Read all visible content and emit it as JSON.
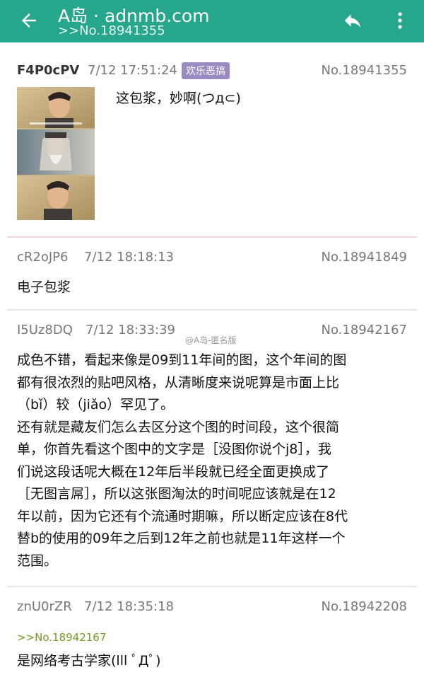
{
  "appbar": {
    "title": "A岛 · adnmb.com",
    "subtitle": ">>No.18941355",
    "back_icon": "back-arrow-icon",
    "reply_icon": "reply-icon",
    "more_icon": "more-vertical-icon",
    "color": "#26a68a"
  },
  "posts": [
    {
      "uid": "F4P0cPV",
      "time": "7/12 17:51:24",
      "tag": "欢乐恶搞",
      "no": "No.18941355",
      "content": "这包浆，妙啊(つд⊂)"
    },
    {
      "uid": "cR2oJP6",
      "time": "7/12 18:18:13",
      "no": "No.18941849",
      "content": "电子包浆"
    },
    {
      "uid": "I5Uz8DQ",
      "time": "7/12 18:33:39",
      "no": "No.18942167",
      "lines": [
        "成色不错，看起来像是09到11年间的图，这个年间的图",
        "都有很浓烈的贴吧风格，从清晰度来说呢算是市面上比",
        "（bǐ）较（jiǎo）罕见了。",
        "还有就是藏友们怎么去区分这个图的时间段，这个很简",
        "单，你首先看这个图中的文字是［没图你说个j8］，我",
        "们说这段话呢大概在12年后半段就已经全面更换成了",
        "［无图言屌］，所以这张图淘汰的时间呢应该就是在12",
        "年以前，因为它还有个流通时期嘛，所以断定应该在8代",
        "替b的使用的09年之后到12年之前也就是11年这样一个",
        "范围。"
      ]
    },
    {
      "uid": "znU0rZR",
      "time": "7/12 18:35:18",
      "no": "No.18942208",
      "quote": ">>No.18942167",
      "content": "是网络考古学家(lll ﾟДﾟ)"
    }
  ],
  "watermark": "@A岛-匿名版"
}
